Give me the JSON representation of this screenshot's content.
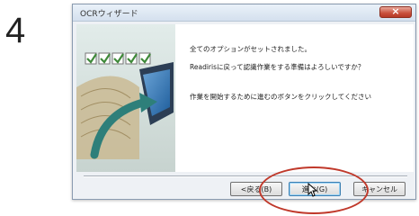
{
  "step_number": "4",
  "window": {
    "title": "OCRウィザード",
    "close_symbol": "×"
  },
  "messages": [
    "全てのオプションがセットされました。",
    "Readirisに戻って認識作業をする準備はよろしいですか？",
    "作業を開始するために進むのボタンをクリックしてください"
  ],
  "buttons": {
    "back": "<戻る(B)",
    "next": "進む(G)",
    "cancel": "キャンセル"
  },
  "colors": {
    "accent_red": "#c0392b",
    "check_green": "#3f8a3a",
    "arrow_teal": "#2e7f7a"
  }
}
